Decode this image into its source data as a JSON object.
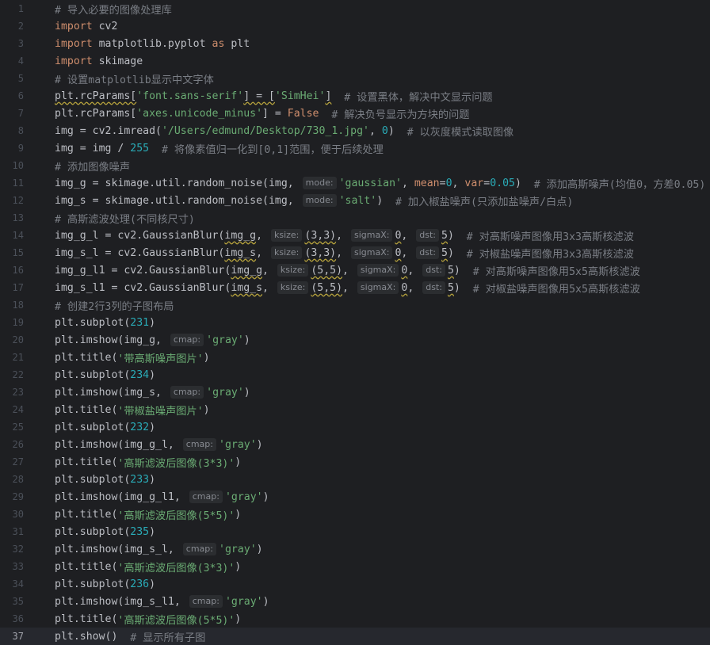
{
  "editor": {
    "current_line": 37,
    "lines": [
      {
        "n": "1",
        "t": [
          [
            "cm",
            "# 导入必要的图像处理库"
          ]
        ]
      },
      {
        "n": "2",
        "t": [
          [
            "kw",
            "import"
          ],
          [
            "",
            " cv2"
          ]
        ]
      },
      {
        "n": "3",
        "t": [
          [
            "kw",
            "import"
          ],
          [
            "",
            " matplotlib.pyplot "
          ],
          [
            "kw",
            "as"
          ],
          [
            "",
            " plt"
          ]
        ]
      },
      {
        "n": "4",
        "t": [
          [
            "kw",
            "import"
          ],
          [
            "",
            " skimage"
          ]
        ]
      },
      {
        "n": "5",
        "t": [
          [
            "cm",
            "# 设置matplotlib显示中文字体"
          ]
        ]
      },
      {
        "n": "6",
        "t": [
          [
            "w",
            "plt.rcParams["
          ],
          [
            "str",
            "'font.sans-serif'"
          ],
          [
            "w",
            "] = ["
          ],
          [
            "str",
            "'SimHei'"
          ],
          [
            "w",
            "]"
          ],
          [
            "cm",
            "  # 设置黑体，解决中文显示问题"
          ]
        ]
      },
      {
        "n": "7",
        "t": [
          [
            "",
            "plt.rcParams["
          ],
          [
            "str",
            "'axes.unicode_minus'"
          ],
          [
            "",
            "] = "
          ],
          [
            "kw",
            "False"
          ],
          [
            "cm",
            "  # 解决负号显示为方块的问题"
          ]
        ]
      },
      {
        "n": "8",
        "t": [
          [
            "",
            "img = cv2.imread("
          ],
          [
            "str",
            "'/Users/edmund/Desktop/730_1.jpg'"
          ],
          [
            "",
            ", "
          ],
          [
            "num",
            "0"
          ],
          [
            "",
            ")  "
          ],
          [
            "cm",
            "# 以灰度模式读取图像"
          ]
        ]
      },
      {
        "n": "9",
        "t": [
          [
            "",
            "img = img / "
          ],
          [
            "num",
            "255"
          ],
          [
            "",
            "  "
          ],
          [
            "cm",
            "# 将像素值归一化到[0,1]范围，便于后续处理"
          ]
        ]
      },
      {
        "n": "10",
        "t": [
          [
            "cm",
            "# 添加图像噪声"
          ]
        ]
      },
      {
        "n": "11",
        "t": [
          [
            "",
            "img_g = skimage.util.random_noise(img, "
          ],
          [
            "hint",
            "mode:"
          ],
          [
            "str",
            "'gaussian'"
          ],
          [
            "",
            ", "
          ],
          [
            "param",
            "mean"
          ],
          [
            "",
            "="
          ],
          [
            "num",
            "0"
          ],
          [
            "",
            ", "
          ],
          [
            "param",
            "var"
          ],
          [
            "",
            "="
          ],
          [
            "num",
            "0.05"
          ],
          [
            "",
            ")  "
          ],
          [
            "cm",
            "# 添加高斯噪声(均值0，方差0.05)"
          ]
        ]
      },
      {
        "n": "12",
        "t": [
          [
            "",
            "img_s = skimage.util.random_noise(img, "
          ],
          [
            "hint",
            "mode:"
          ],
          [
            "str",
            "'salt'"
          ],
          [
            "",
            ")  "
          ],
          [
            "cm",
            "# 加入椒盐噪声(只添加盐噪声/白点)"
          ]
        ]
      },
      {
        "n": "13",
        "t": [
          [
            "cm",
            "# 高斯滤波处理(不同核尺寸)"
          ]
        ]
      },
      {
        "n": "14",
        "t": [
          [
            "",
            "img_g_l = cv2.GaussianBlur("
          ],
          [
            "w",
            "img_g"
          ],
          [
            "",
            ", "
          ],
          [
            "hint",
            "ksize:"
          ],
          [
            "w",
            "(3,3)"
          ],
          [
            "",
            ", "
          ],
          [
            "hint",
            "sigmaX:"
          ],
          [
            "w",
            "0"
          ],
          [
            "",
            ", "
          ],
          [
            "hint",
            "dst:"
          ],
          [
            "w",
            "5"
          ],
          [
            "",
            ")  "
          ],
          [
            "cm",
            "# 对高斯噪声图像用3x3高斯核滤波"
          ]
        ]
      },
      {
        "n": "15",
        "t": [
          [
            "",
            "img_s_l = cv2.GaussianBlur("
          ],
          [
            "w",
            "img_s"
          ],
          [
            "",
            ", "
          ],
          [
            "hint",
            "ksize:"
          ],
          [
            "w",
            "(3,3)"
          ],
          [
            "",
            ", "
          ],
          [
            "hint",
            "sigmaX:"
          ],
          [
            "w",
            "0"
          ],
          [
            "",
            ", "
          ],
          [
            "hint",
            "dst:"
          ],
          [
            "w",
            "5"
          ],
          [
            "",
            ")  "
          ],
          [
            "cm",
            "# 对椒盐噪声图像用3x3高斯核滤波"
          ]
        ]
      },
      {
        "n": "16",
        "t": [
          [
            "",
            "img_g_l1 = cv2.GaussianBlur("
          ],
          [
            "w",
            "img_g"
          ],
          [
            "",
            ", "
          ],
          [
            "hint",
            "ksize:"
          ],
          [
            "w",
            "(5,5)"
          ],
          [
            "",
            ", "
          ],
          [
            "hint",
            "sigmaX:"
          ],
          [
            "w",
            "0"
          ],
          [
            "",
            ", "
          ],
          [
            "hint",
            "dst:"
          ],
          [
            "w",
            "5"
          ],
          [
            "",
            ")  "
          ],
          [
            "cm",
            "# 对高斯噪声图像用5x5高斯核滤波"
          ]
        ]
      },
      {
        "n": "17",
        "t": [
          [
            "",
            "img_s_l1 = cv2.GaussianBlur("
          ],
          [
            "w",
            "img_s"
          ],
          [
            "",
            ", "
          ],
          [
            "hint",
            "ksize:"
          ],
          [
            "w",
            "(5,5)"
          ],
          [
            "",
            ", "
          ],
          [
            "hint",
            "sigmaX:"
          ],
          [
            "w",
            "0"
          ],
          [
            "",
            ", "
          ],
          [
            "hint",
            "dst:"
          ],
          [
            "w",
            "5"
          ],
          [
            "",
            ")  "
          ],
          [
            "cm",
            "# 对椒盐噪声图像用5x5高斯核滤波"
          ]
        ]
      },
      {
        "n": "18",
        "t": [
          [
            "cm",
            "# 创建2行3列的子图布局"
          ]
        ]
      },
      {
        "n": "19",
        "t": [
          [
            "",
            "plt.subplot("
          ],
          [
            "num",
            "231"
          ],
          [
            "",
            ")"
          ]
        ]
      },
      {
        "n": "20",
        "t": [
          [
            "",
            "plt.imshow(img_g, "
          ],
          [
            "hint",
            "cmap:"
          ],
          [
            "str",
            "'gray'"
          ],
          [
            "",
            ")"
          ]
        ]
      },
      {
        "n": "21",
        "t": [
          [
            "",
            "plt.title("
          ],
          [
            "str",
            "'带高斯噪声图片'"
          ],
          [
            "",
            ")"
          ]
        ]
      },
      {
        "n": "22",
        "t": [
          [
            "",
            "plt.subplot("
          ],
          [
            "num",
            "234"
          ],
          [
            "",
            ")"
          ]
        ]
      },
      {
        "n": "23",
        "t": [
          [
            "",
            "plt.imshow(img_s, "
          ],
          [
            "hint",
            "cmap:"
          ],
          [
            "str",
            "'gray'"
          ],
          [
            "",
            ")"
          ]
        ]
      },
      {
        "n": "24",
        "t": [
          [
            "",
            "plt.title("
          ],
          [
            "str",
            "'带椒盐噪声图片'"
          ],
          [
            "",
            ")"
          ]
        ]
      },
      {
        "n": "25",
        "t": [
          [
            "",
            "plt.subplot("
          ],
          [
            "num",
            "232"
          ],
          [
            "",
            ")"
          ]
        ]
      },
      {
        "n": "26",
        "t": [
          [
            "",
            "plt.imshow(img_g_l, "
          ],
          [
            "hint",
            "cmap:"
          ],
          [
            "str",
            "'gray'"
          ],
          [
            "",
            ")"
          ]
        ]
      },
      {
        "n": "27",
        "t": [
          [
            "",
            "plt.title("
          ],
          [
            "str",
            "'高斯滤波后图像(3*3)'"
          ],
          [
            "",
            ")"
          ]
        ]
      },
      {
        "n": "28",
        "t": [
          [
            "",
            "plt.subplot("
          ],
          [
            "num",
            "233"
          ],
          [
            "",
            ")"
          ]
        ]
      },
      {
        "n": "29",
        "t": [
          [
            "",
            "plt.imshow(img_g_l1, "
          ],
          [
            "hint",
            "cmap:"
          ],
          [
            "str",
            "'gray'"
          ],
          [
            "",
            ")"
          ]
        ]
      },
      {
        "n": "30",
        "t": [
          [
            "",
            "plt.title("
          ],
          [
            "str",
            "'高斯滤波后图像(5*5)'"
          ],
          [
            "",
            ")"
          ]
        ]
      },
      {
        "n": "31",
        "t": [
          [
            "",
            "plt.subplot("
          ],
          [
            "num",
            "235"
          ],
          [
            "",
            ")"
          ]
        ]
      },
      {
        "n": "32",
        "t": [
          [
            "",
            "plt.imshow(img_s_l, "
          ],
          [
            "hint",
            "cmap:"
          ],
          [
            "str",
            "'gray'"
          ],
          [
            "",
            ")"
          ]
        ]
      },
      {
        "n": "33",
        "t": [
          [
            "",
            "plt.title("
          ],
          [
            "str",
            "'高斯滤波后图像(3*3)'"
          ],
          [
            "",
            ")"
          ]
        ]
      },
      {
        "n": "34",
        "t": [
          [
            "",
            "plt.subplot("
          ],
          [
            "num",
            "236"
          ],
          [
            "",
            ")"
          ]
        ]
      },
      {
        "n": "35",
        "t": [
          [
            "",
            "plt.imshow(img_s_l1, "
          ],
          [
            "hint",
            "cmap:"
          ],
          [
            "str",
            "'gray'"
          ],
          [
            "",
            ")"
          ]
        ]
      },
      {
        "n": "36",
        "t": [
          [
            "",
            "plt.title("
          ],
          [
            "str",
            "'高斯滤波后图像(5*5)'"
          ],
          [
            "",
            ")"
          ]
        ]
      },
      {
        "n": "37",
        "t": [
          [
            "",
            "plt.show()  "
          ],
          [
            "cm",
            "# 显示所有子图"
          ]
        ]
      }
    ]
  }
}
